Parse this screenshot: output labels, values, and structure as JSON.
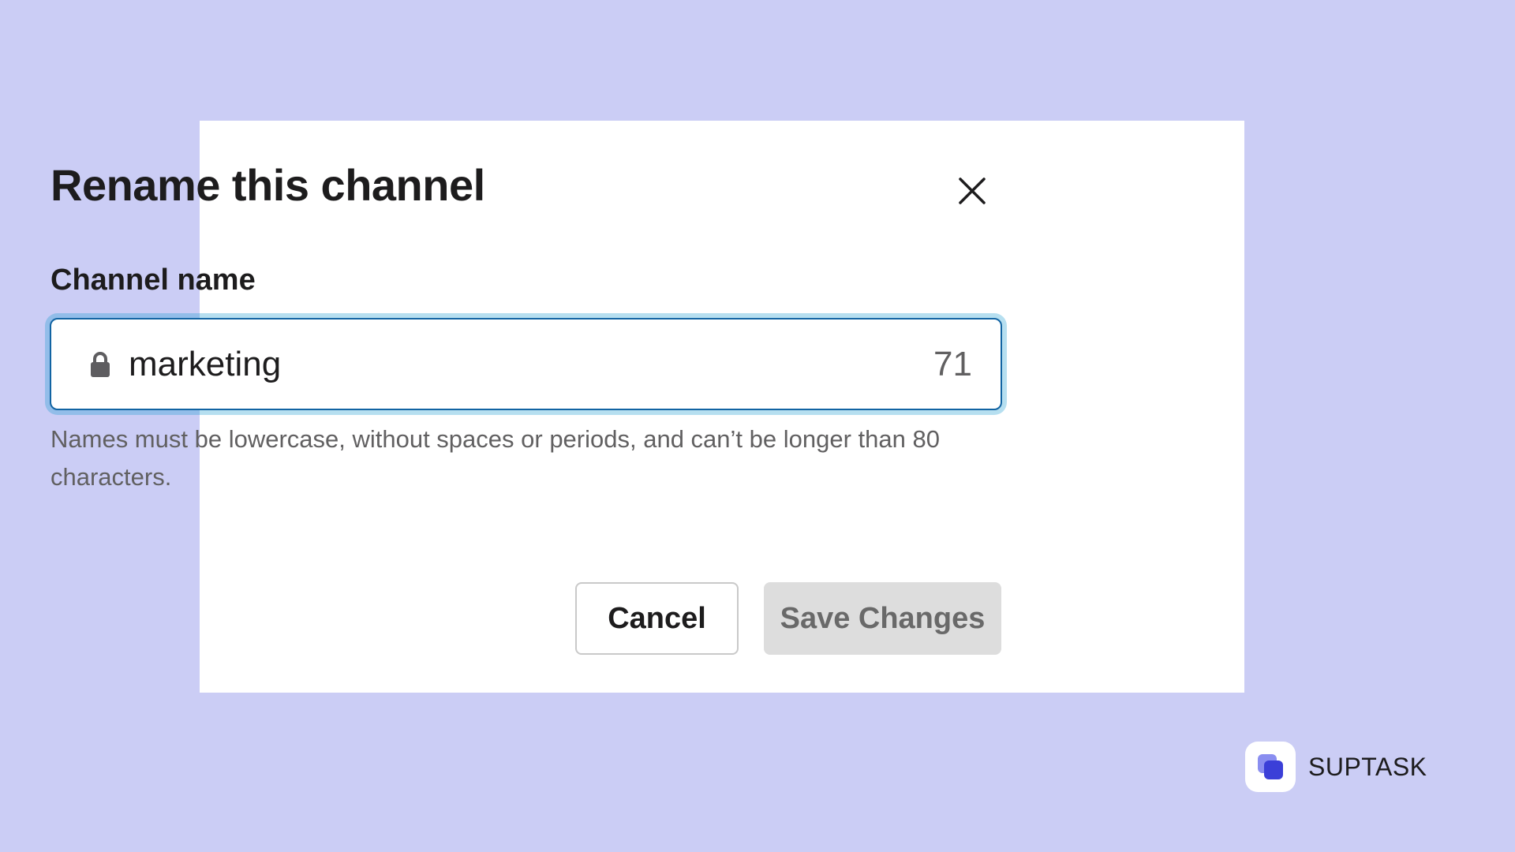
{
  "modal": {
    "title": "Rename this channel",
    "close_icon": "close-icon",
    "field": {
      "label": "Channel name",
      "icon": "lock-icon",
      "value": "marketing",
      "remaining_count": "71"
    },
    "helper_text": "Names must be lowercase, without spaces or periods, and can’t be longer than 80 characters.",
    "buttons": {
      "cancel_label": "Cancel",
      "save_label": "Save Changes"
    }
  },
  "brand": {
    "name": "SUPTASK",
    "logo_icon": "suptask-logo-icon"
  },
  "colors": {
    "background": "#cbcdf5",
    "modal": "#ffffff",
    "focus_border": "#1264a3",
    "focus_glow": "#1d9bd1",
    "text_primary": "#1d1c1d",
    "text_secondary": "#616061",
    "save_disabled_bg": "#dddddd",
    "brand_accent": "#3b3fd8"
  }
}
